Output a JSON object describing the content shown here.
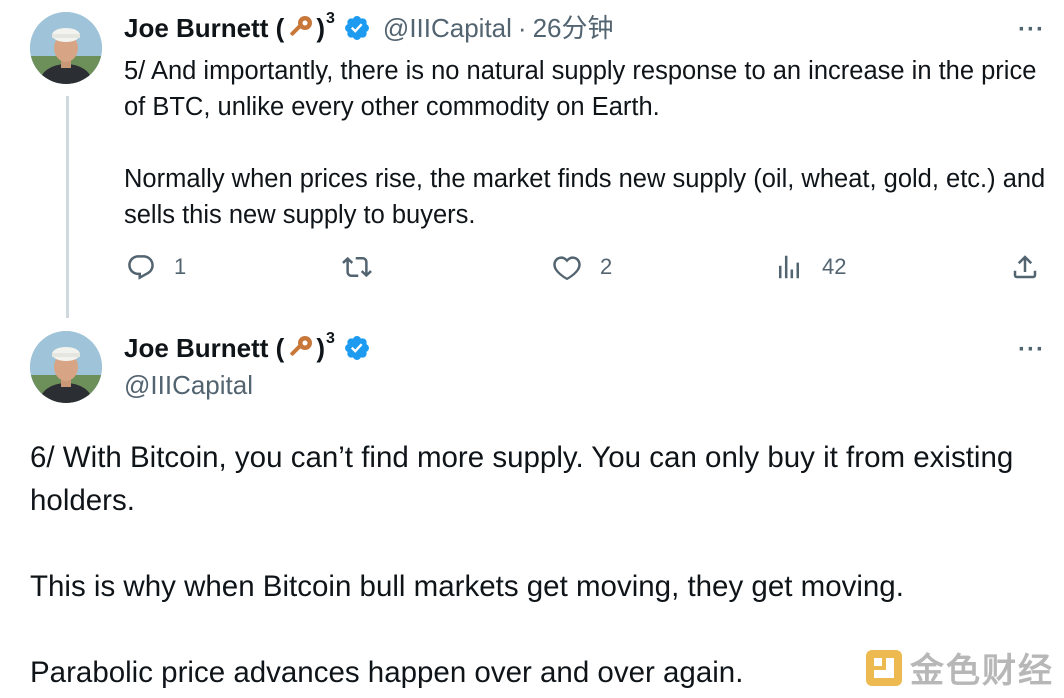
{
  "tweets": [
    {
      "author": "Joe Burnett (",
      "author_suffix": ")",
      "superscript": "3",
      "handle": "@IIICapital",
      "separator": "·",
      "time": "26分钟",
      "more": "···",
      "paragraphs": [
        "5/ And importantly, there is no natural supply response to an increase in the price of BTC, unlike every other commodity on Earth.",
        "Normally when prices rise, the market finds new supply (oil, wheat, gold, etc.) and sells this new supply to buyers."
      ],
      "actions": {
        "reply_count": "1",
        "retweet_count": "",
        "like_count": "2",
        "views_count": "42"
      }
    },
    {
      "author": "Joe Burnett (",
      "author_suffix": ")",
      "superscript": "3",
      "handle": "@IIICapital",
      "more": "···",
      "paragraphs": [
        "6/ With Bitcoin, you can’t find more supply. You can only buy it from existing holders.",
        "This is why when Bitcoin bull markets get moving, they get moving.",
        "Parabolic price advances happen over and over again."
      ]
    }
  ],
  "watermark": {
    "text": "金色财经"
  },
  "icons": {
    "verified": "verified-badge-icon",
    "key": "key-emoji-icon",
    "reply": "reply-icon",
    "retweet": "retweet-icon",
    "like": "heart-icon",
    "views": "views-chart-icon",
    "share": "share-icon"
  },
  "colors": {
    "verified": "#1d9bf0",
    "text": "#0f1419",
    "secondary": "#536471",
    "thread_line": "#cfd9de"
  }
}
